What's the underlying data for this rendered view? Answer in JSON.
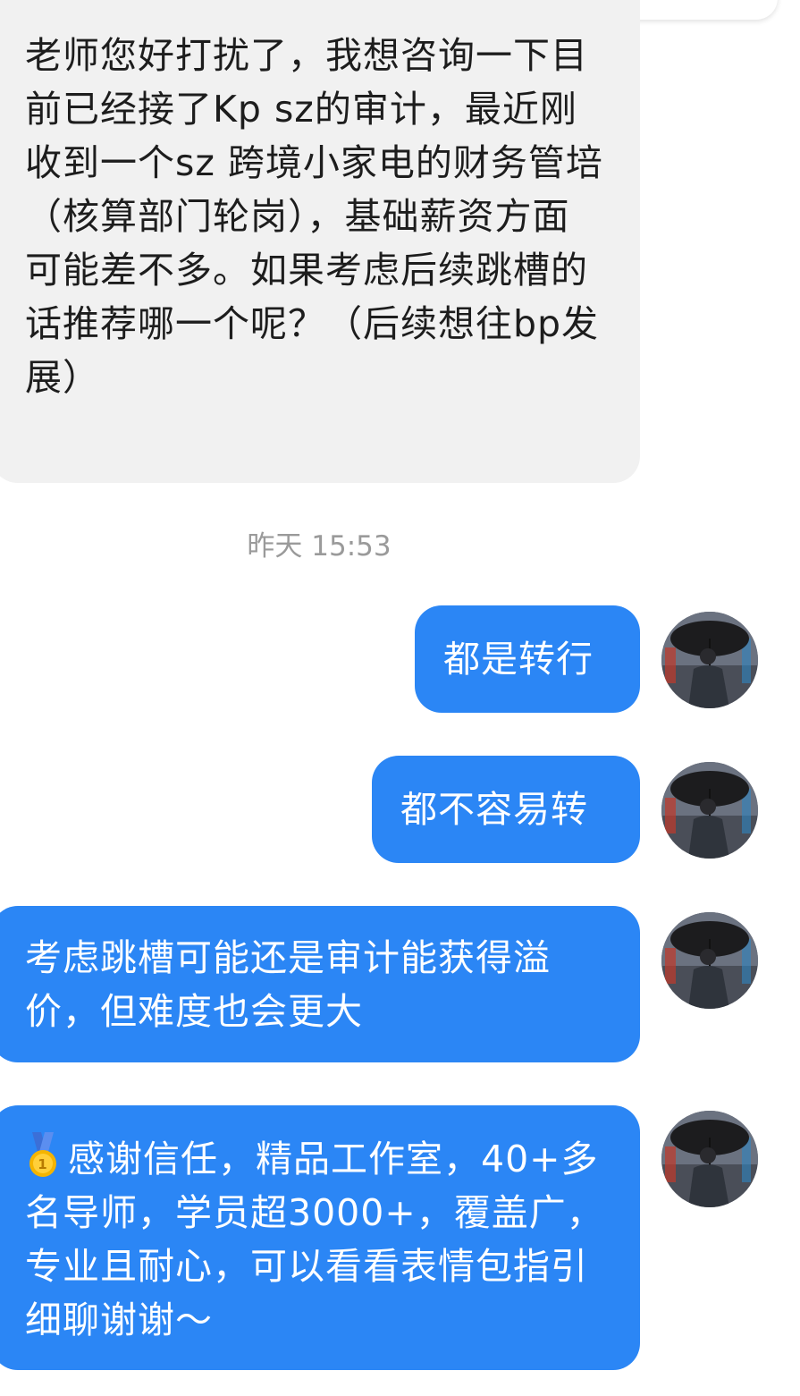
{
  "incoming": {
    "message": "老师您好打扰了，我想咨询一下目前已经接了Kp sz的审计，最近刚收到一个sz 跨境小家电的财务管培（核算部门轮岗），基础薪资方面可能差不多。如果考虑后续跳槽的话推荐哪一个呢？（后续想往bp发展）"
  },
  "timestamp": "昨天 15:53",
  "outgoing": [
    {
      "text": "都是转行"
    },
    {
      "text": "都不容易转"
    },
    {
      "text": "考虑跳槽可能还是审计能获得溢价，但难度也会更大"
    },
    {
      "emoji": "medal-icon",
      "text": "感谢信任，精品工作室，40+多名导师，学员超3000+，覆盖广，专业且耐心，可以看看表情包指引细聊谢谢～"
    }
  ],
  "colors": {
    "outgoing_bubble": "#2b86f5",
    "incoming_bubble": "#f1f1f1",
    "timestamp_text": "#9a9a9a"
  }
}
